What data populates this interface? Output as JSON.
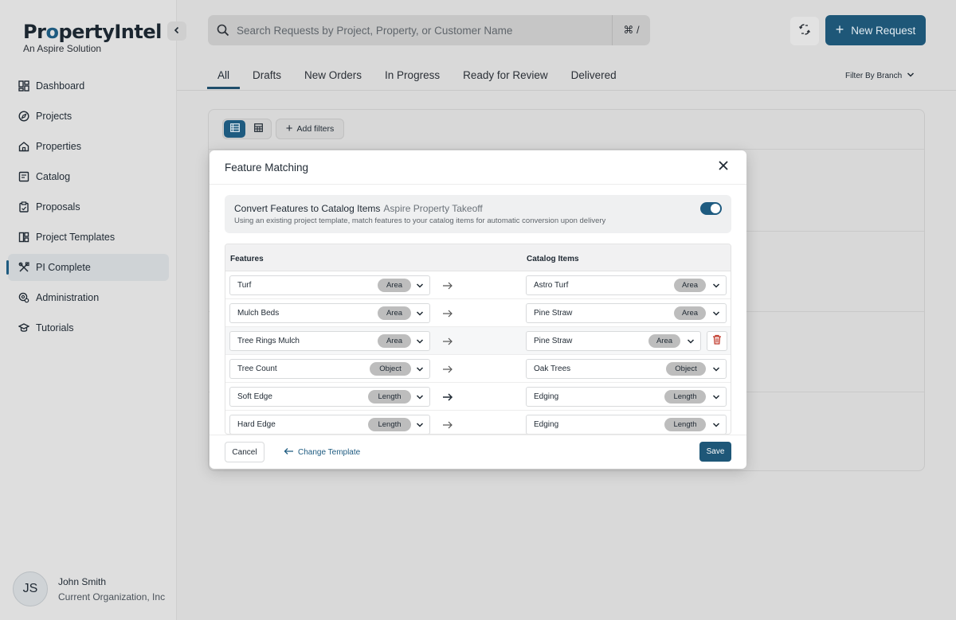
{
  "brand": {
    "name_part1": "Pr",
    "name_dot": "o",
    "name_part2": "pertyIntel",
    "tagline": "An Aspire Solution"
  },
  "sidebar": {
    "items": [
      {
        "label": "Dashboard",
        "icon": "dashboard-icon"
      },
      {
        "label": "Projects",
        "icon": "compass-icon"
      },
      {
        "label": "Properties",
        "icon": "house-icon"
      },
      {
        "label": "Catalog",
        "icon": "catalog-icon"
      },
      {
        "label": "Proposals",
        "icon": "clipboard-icon"
      },
      {
        "label": "Project Templates",
        "icon": "template-icon"
      },
      {
        "label": "PI Complete",
        "icon": "tools-icon",
        "active": true
      },
      {
        "label": "Administration",
        "icon": "admin-icon"
      },
      {
        "label": "Tutorials",
        "icon": "graduation-cap-icon"
      }
    ],
    "user": {
      "initials": "JS",
      "name": "John Smith",
      "org": "Current Organization, Inc"
    }
  },
  "header": {
    "search_placeholder": "Search Requests by Project, Property, or Customer Name",
    "shortcut": "⌘ /",
    "new_request_label": "New Request"
  },
  "tabs": [
    {
      "label": "All",
      "active": true
    },
    {
      "label": "Drafts"
    },
    {
      "label": "New Orders"
    },
    {
      "label": "In Progress"
    },
    {
      "label": "Ready for Review"
    },
    {
      "label": "Delivered"
    }
  ],
  "filter_branch_label": "Filter By Branch",
  "toolbar": {
    "add_filters_label": "Add filters"
  },
  "modal": {
    "title": "Feature Matching",
    "convert": {
      "title": "Convert Features to Catalog Items",
      "template_name": "Aspire Property Takeoff",
      "description": "Using an existing project template, match features to your catalog items for automatic conversion upon delivery",
      "enabled": true
    },
    "columns": {
      "features": "Features",
      "catalog_items": "Catalog Items"
    },
    "rows": [
      {
        "feature": "Turf",
        "feature_type": "Area",
        "catalog": "Astro Turf",
        "catalog_type": "Area"
      },
      {
        "feature": "Mulch Beds",
        "feature_type": "Area",
        "catalog": "Pine Straw",
        "catalog_type": "Area"
      },
      {
        "feature": "Tree Rings Mulch",
        "feature_type": "Area",
        "catalog": "Pine Straw",
        "catalog_type": "Area"
      },
      {
        "feature": "Tree Count",
        "feature_type": "Object",
        "catalog": "Oak Trees",
        "catalog_type": "Object"
      },
      {
        "feature": "Soft Edge",
        "feature_type": "Length",
        "catalog": "Edging",
        "catalog_type": "Length"
      },
      {
        "feature": "Hard Edge",
        "feature_type": "Length",
        "catalog": "Edging",
        "catalog_type": "Length"
      }
    ],
    "cancel_label": "Cancel",
    "change_template_label": "Change Template",
    "save_label": "Save"
  }
}
